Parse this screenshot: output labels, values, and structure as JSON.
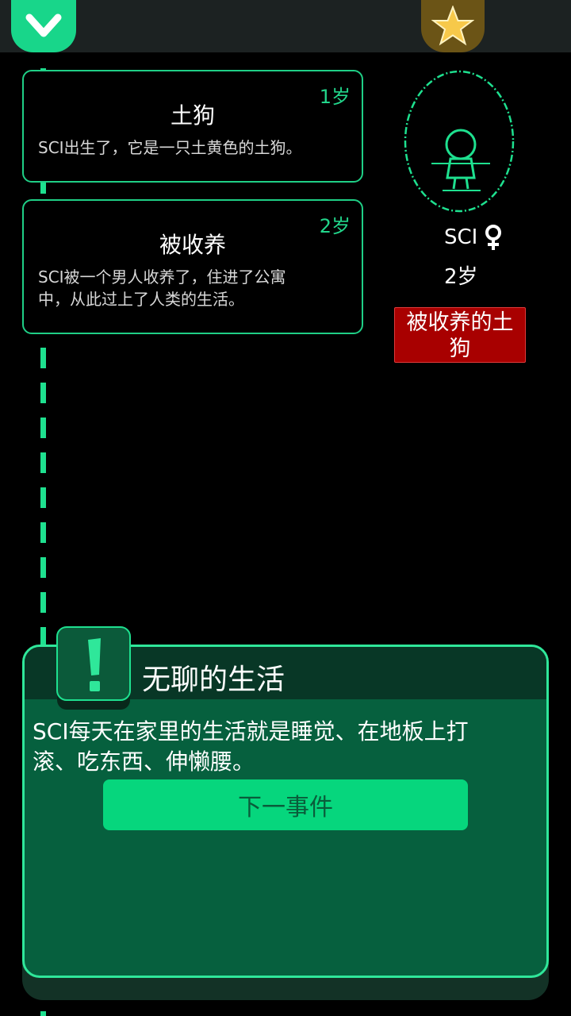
{
  "topbar": {
    "left_icon": "chevron-down-icon",
    "right_icon": "star-icon"
  },
  "timeline": {
    "events": [
      {
        "age": "1岁",
        "title": "土狗",
        "desc_lines": [
          "SCI出生了，它是一只土黄色的土狗。"
        ]
      },
      {
        "age": "2岁",
        "title": "被收养",
        "desc_lines": [
          "SCI被一个男人收养了，住进了公寓",
          "中，从此过上了人类的生活。"
        ]
      }
    ]
  },
  "character": {
    "name": "SCI",
    "gender_icon": "female-icon",
    "age": "2岁",
    "status_lines": [
      "被收养的土",
      "狗"
    ]
  },
  "dialog": {
    "icon": "exclamation-icon",
    "title": "无聊的生活",
    "text_lines": [
      "SCI每天在家里的生活就是睡觉、在地板上打",
      "滚、吃东西、伸懒腰。"
    ],
    "button_label": "下一事件"
  },
  "colors": {
    "accent": "#1ee08f",
    "panel": "#06603e",
    "badge": "#a80000",
    "star_bg": "#6b5416"
  }
}
